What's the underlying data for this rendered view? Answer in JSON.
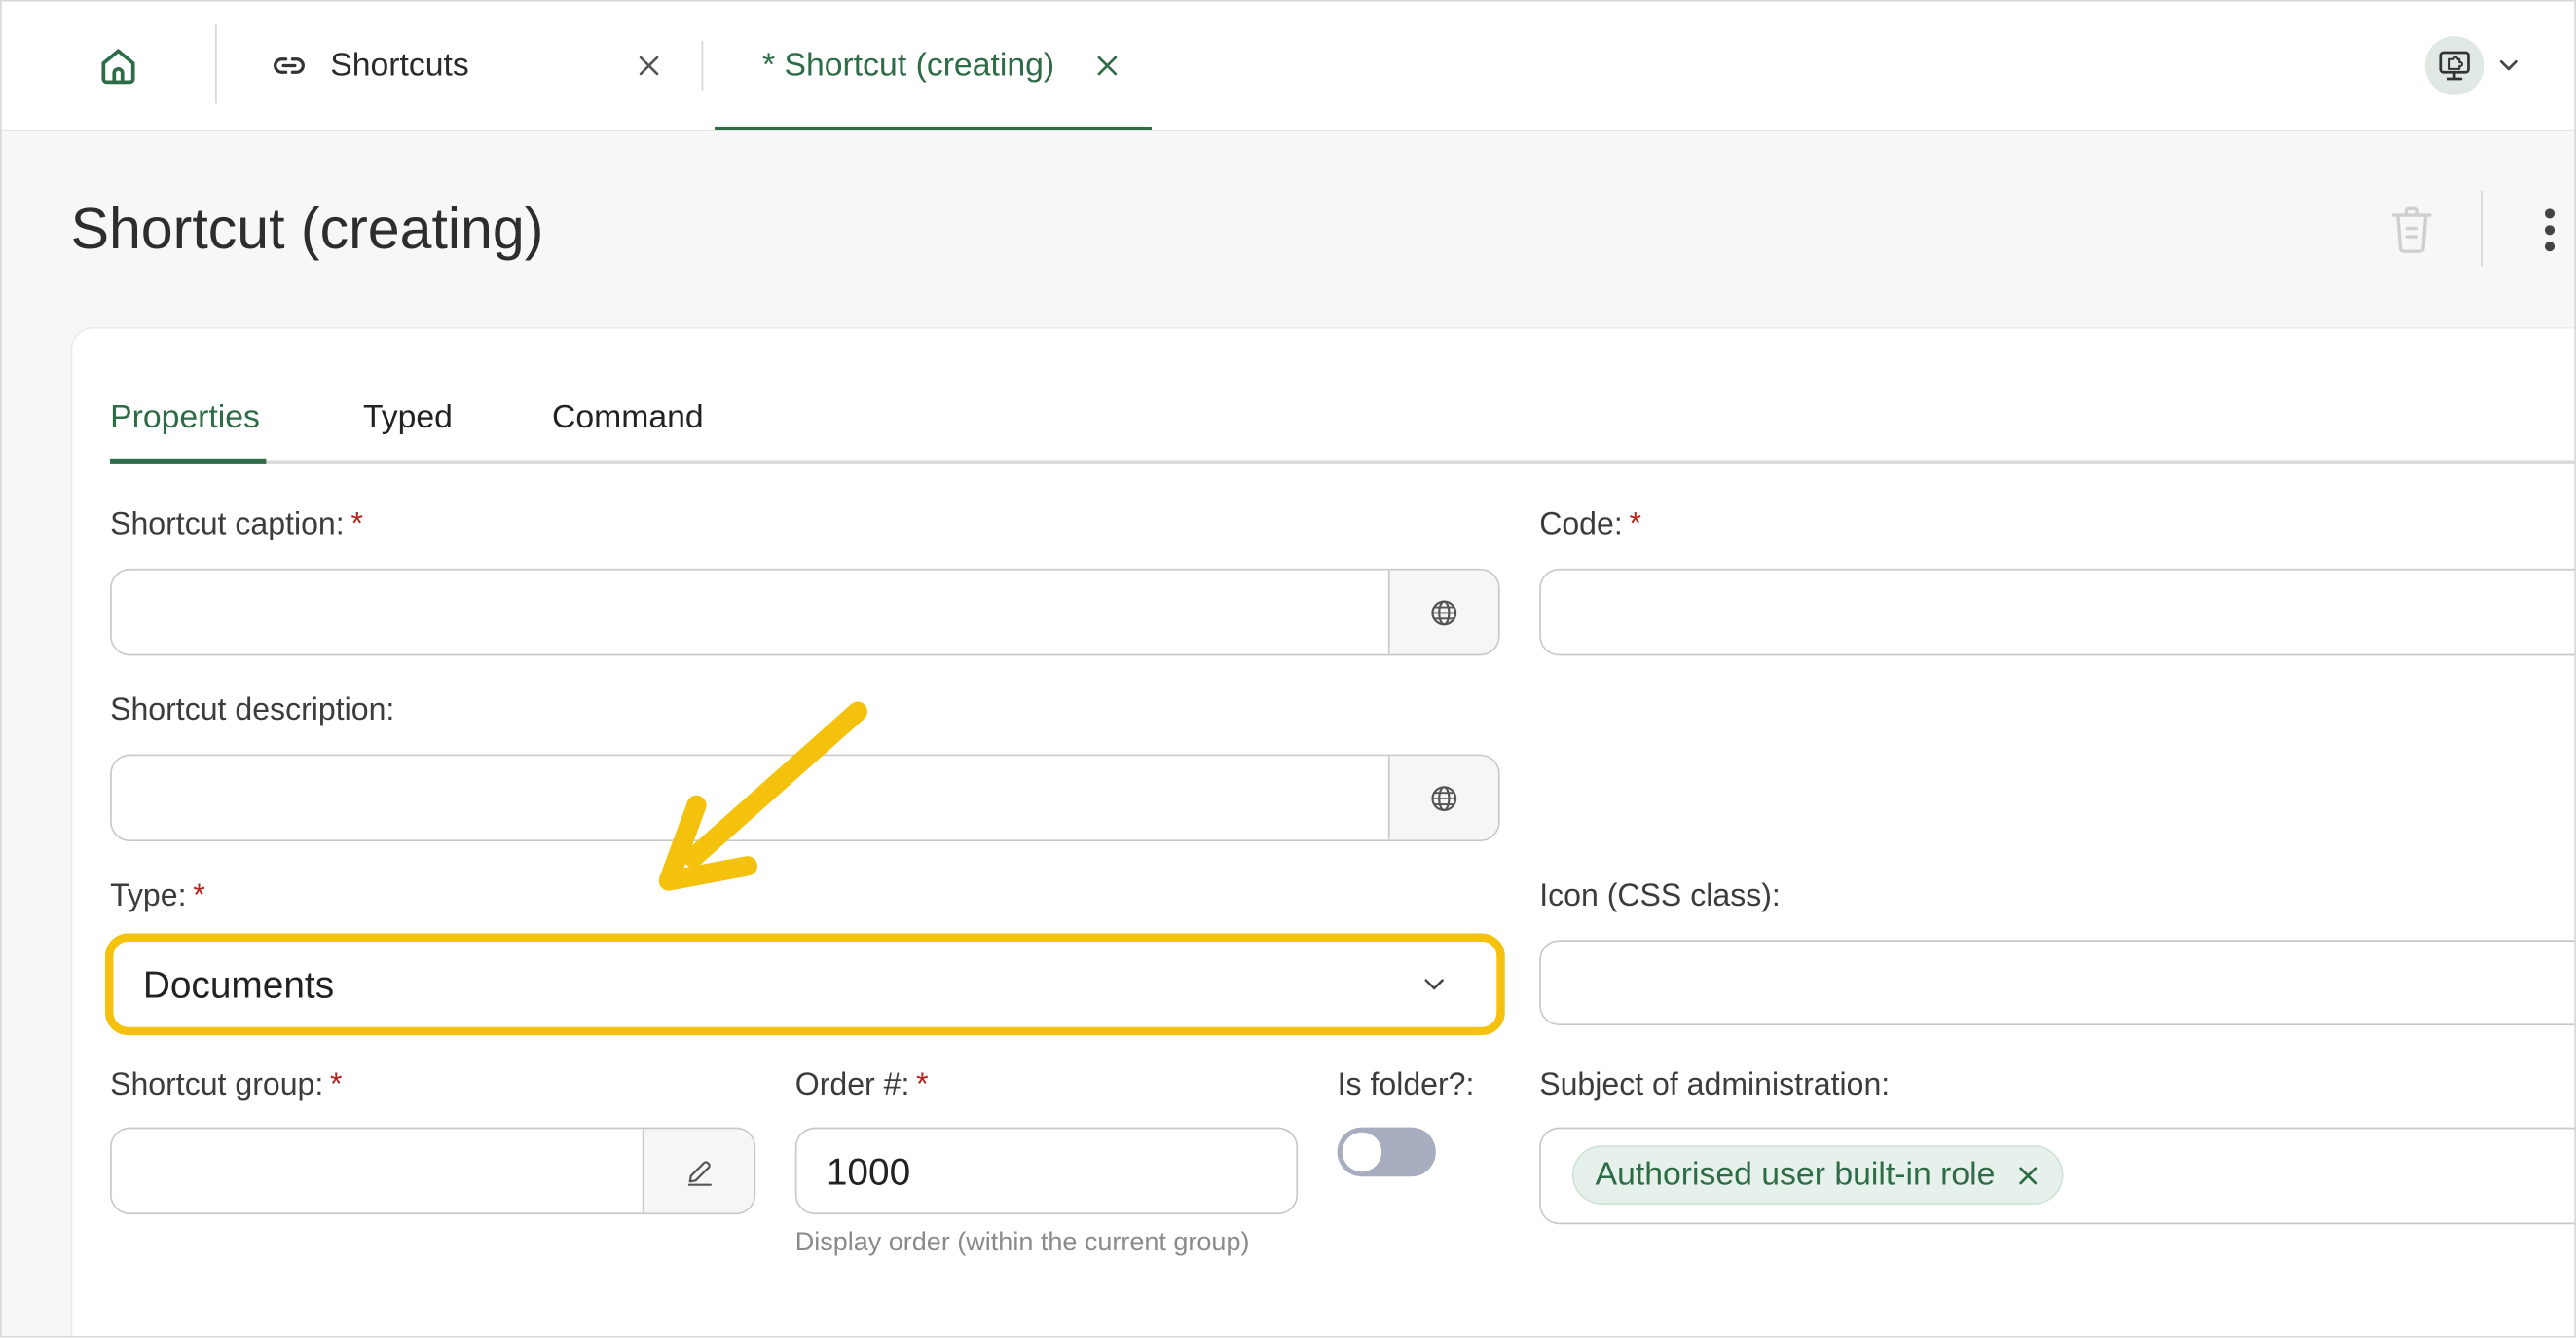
{
  "colors": {
    "accent": "#2e6b47",
    "highlight": "#f4c20d",
    "required": "#b3261e",
    "chip_bg": "#e7f1eb",
    "toggle_off": "#a7adbf"
  },
  "topbar": {
    "home_icon": "home-icon",
    "tabs": [
      {
        "label": "Shortcuts",
        "icon": "link-icon",
        "active": false
      },
      {
        "label": "* Shortcut (creating)",
        "active": true
      }
    ],
    "user_menu_icon": "remote-desktop-icon"
  },
  "header": {
    "title": "Shortcut (creating)",
    "delete_icon": "trash-icon",
    "more_icon": "more-vertical-icon"
  },
  "form": {
    "tabs": [
      "Properties",
      "Typed",
      "Command"
    ],
    "active_tab": "Properties",
    "required_mark": "*",
    "caption": {
      "label": "Shortcut caption:",
      "value": "",
      "addon_icon": "globe-icon"
    },
    "code": {
      "label": "Code:",
      "value": ""
    },
    "description": {
      "label": "Shortcut description:",
      "value": "",
      "addon_icon": "globe-icon"
    },
    "type": {
      "label": "Type:",
      "value": "Documents"
    },
    "icon_css": {
      "label": "Icon (CSS class):",
      "value": ""
    },
    "group": {
      "label": "Shortcut group:",
      "value": "",
      "addon_icon": "pencil-icon"
    },
    "order": {
      "label": "Order #:",
      "value": "1000",
      "hint": "Display order (within the current group)"
    },
    "is_folder": {
      "label": "Is folder?:",
      "on": false
    },
    "subject": {
      "label": "Subject of administration:",
      "chips": [
        "Authorised user built-in role"
      ]
    }
  }
}
